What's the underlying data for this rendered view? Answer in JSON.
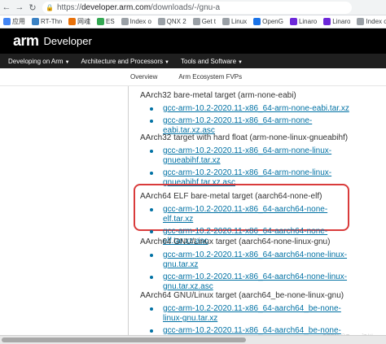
{
  "browser": {
    "url_prefix": "https://",
    "url_host": "developer.arm.com",
    "url_path": "/downloads/-/gnu-a",
    "bookmarks": [
      {
        "label": "应用",
        "color": "#4285f4"
      },
      {
        "label": "RT-Thre",
        "color": "#3b82c4"
      },
      {
        "label": "网魂",
        "color": "#e8710a"
      },
      {
        "label": "ES",
        "color": "#34a853"
      },
      {
        "label": "Index of",
        "color": "#9aa0a6"
      },
      {
        "label": "QNX 2",
        "color": "#9aa0a6"
      },
      {
        "label": "Get t",
        "color": "#9aa0a6"
      },
      {
        "label": "Linux",
        "color": "#9aa0a6"
      },
      {
        "label": "OpenG",
        "color": "#1a73e8"
      },
      {
        "label": "Linaro",
        "color": "#6d28d9"
      },
      {
        "label": "Linaro",
        "color": "#6d28d9"
      },
      {
        "label": "Index o",
        "color": "#9aa0a6"
      },
      {
        "label": "RT-Thr",
        "color": "#3b82c4"
      }
    ]
  },
  "header": {
    "logo": "arm",
    "subtitle": "Developer"
  },
  "main_nav": [
    {
      "label": "Developing on Arm"
    },
    {
      "label": "Architecture and Processors"
    },
    {
      "label": "Tools and Software"
    }
  ],
  "sub_nav": [
    {
      "label": "Overview"
    },
    {
      "label": "Arm Ecosystem FVPs"
    }
  ],
  "groups": [
    {
      "title": "AArch32 bare-metal target (arm-none-eabi)",
      "links": [
        "gcc-arm-10.2-2020.11-x86_64-arm-none-eabi.tar.xz",
        "gcc-arm-10.2-2020.11-x86_64-arm-none-eabi.tar.xz.asc"
      ]
    },
    {
      "title": "AArch32 target with hard float (arm-none-linux-gnueabihf)",
      "links": [
        "gcc-arm-10.2-2020.11-x86_64-arm-none-linux-gnueabihf.tar.xz",
        "gcc-arm-10.2-2020.11-x86_64-arm-none-linux-gnueabihf.tar.xz.asc"
      ]
    },
    {
      "title": "AArch64 ELF bare-metal target (aarch64-none-elf)",
      "links": [
        "gcc-arm-10.2-2020.11-x86_64-aarch64-none-elf.tar.xz",
        "gcc-arm-10.2-2020.11-x86_64-aarch64-none-elf.tar.xz.asc"
      ]
    },
    {
      "title": "AArch64 GNU/Linux target (aarch64-none-linux-gnu)",
      "links": [
        "gcc-arm-10.2-2020.11-x86_64-aarch64-none-linux-gnu.tar.xz",
        "gcc-arm-10.2-2020.11-x86_64-aarch64-none-linux-gnu.tar.xz.asc"
      ]
    },
    {
      "title": "AArch64 GNU/Linux target (aarch64_be-none-linux-gnu)",
      "links": [
        "gcc-arm-10.2-2020.11-x86_64-aarch64_be-none-linux-gnu.tar.xz",
        "gcc-arm-10.2-2020.11-x86_64-aarch64_be-none-linux-gnu.tar.xz.asc"
      ]
    }
  ],
  "colors": {
    "link": "#0071a4",
    "highlight_border": "#d93b3b",
    "header_bg": "#000000"
  },
  "watermark": "CSDN @Tango江川"
}
